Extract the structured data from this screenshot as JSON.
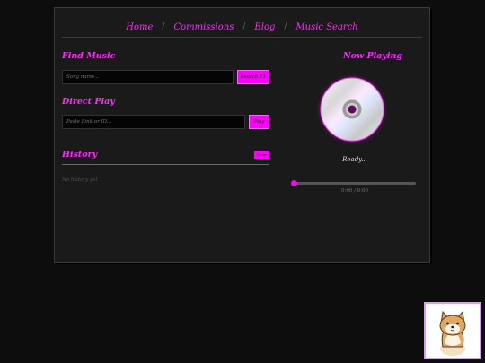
{
  "nav": {
    "items": [
      "Home",
      "Commissions",
      "Blog",
      "Music Search"
    ],
    "separator": "/"
  },
  "find_music": {
    "title": "Find Music",
    "placeholder": "Song name...",
    "button": "Search YT"
  },
  "direct_play": {
    "title": "Direct Play",
    "placeholder": "Paste Link or ID...",
    "button": "Play"
  },
  "history": {
    "title": "History",
    "clear_button": "Clear",
    "empty_text": "No history yet"
  },
  "player": {
    "title": "Now Playing",
    "status": "Ready...",
    "time": "0:00 / 0:00",
    "progress": 0
  },
  "colors": {
    "accent": "#ff00ff",
    "panel": "#1a1a1a",
    "background": "#0d0d0d"
  },
  "icons": {
    "cd": "cd-disc-icon",
    "dog": "shiba-dog-sticker"
  }
}
